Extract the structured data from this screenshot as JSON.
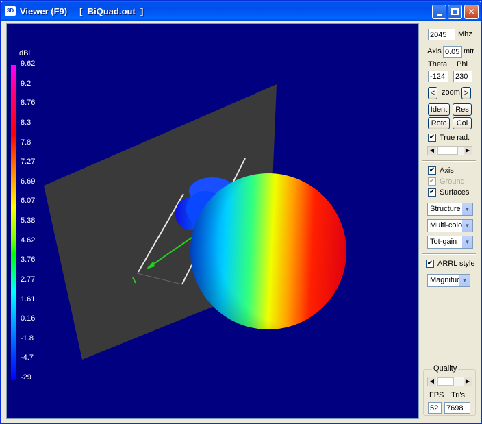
{
  "window": {
    "icon_text": "3D",
    "title": "Viewer (F9)     [  BiQuad.out  ]"
  },
  "legend": {
    "unit": "dBi",
    "labels": [
      "9.62",
      "9.2",
      "8.76",
      "8.3",
      "7.8",
      "7.27",
      "6.69",
      "6.07",
      "5.38",
      "4.62",
      "3.76",
      "2.77",
      "1.61",
      "0.16",
      "-1.8",
      "-4.7",
      "-29"
    ]
  },
  "panel": {
    "frequency": "2045",
    "frequency_unit": "Mhz",
    "axis_label": "Axis",
    "axis_value": "0.05",
    "axis_unit": "mtr",
    "theta_label": "Theta",
    "phi_label": "Phi",
    "theta_value": "-124",
    "phi_value": "230",
    "zoom_label": "zoom",
    "zoom_left": "<",
    "zoom_right": ">",
    "ident_label": "Ident",
    "res_label": "Res",
    "rotc_label": "Rotc",
    "col_label": "Col",
    "true_rad_label": "True rad.",
    "axis_check_label": "Axis",
    "ground_label": "Ground",
    "surfaces_label": "Surfaces",
    "structure_select": "Structure",
    "color_select": "Multi-color",
    "gain_select": "Tot-gain",
    "arrl_label": "ARRL style",
    "magnitude_select": "Magnitude",
    "quality_label": "Quality",
    "fps_label": "FPS",
    "tris_label": "Tri's",
    "fps_value": "52",
    "tris_value": "7698"
  },
  "colors": {
    "titlebar": "#0053ee",
    "viewport_bg": "#000080",
    "plate": "#3a3a3a"
  }
}
